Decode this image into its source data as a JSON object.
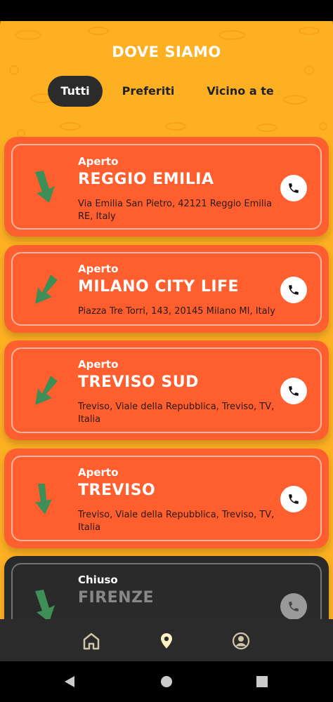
{
  "header": {
    "title": "DOVE SIAMO"
  },
  "tabs": [
    {
      "label": "Tutti",
      "active": true
    },
    {
      "label": "Preferiti",
      "active": false
    },
    {
      "label": "Vicino a te",
      "active": false
    }
  ],
  "locations": [
    {
      "status": "Aperto",
      "name": "REGGIO EMILIA",
      "address": "Via Emilia San Pietro, 42121 Reggio Emilia RE, Italy"
    },
    {
      "status": "Aperto",
      "name": "MILANO CITY LIFE",
      "address": "Piazza Tre Torri, 143, 20145 Milano MI, Italy"
    },
    {
      "status": "Aperto",
      "name": "TREVISO SUD",
      "address": "Treviso, Viale della Repubblica, Treviso, TV, Italia"
    },
    {
      "status": "Aperto",
      "name": "TREVISO",
      "address": "Treviso, Viale della Repubblica, Treviso, TV, Italia"
    },
    {
      "status": "Chiuso",
      "name": "FIRENZE",
      "address": ""
    }
  ],
  "icons": {
    "direction": "direction-arrow-icon",
    "call": "phone-icon",
    "nav": [
      "home-icon",
      "location-pin-icon",
      "profile-icon"
    ],
    "system": [
      "back-icon",
      "home-circle-icon",
      "recents-square-icon"
    ]
  },
  "colors": {
    "background": "#FDB022",
    "card_open": "#FF5E2E",
    "card_closed": "#2A2A2A",
    "arrow": "#3E8E57",
    "nav_bar": "#2B2B2B"
  }
}
